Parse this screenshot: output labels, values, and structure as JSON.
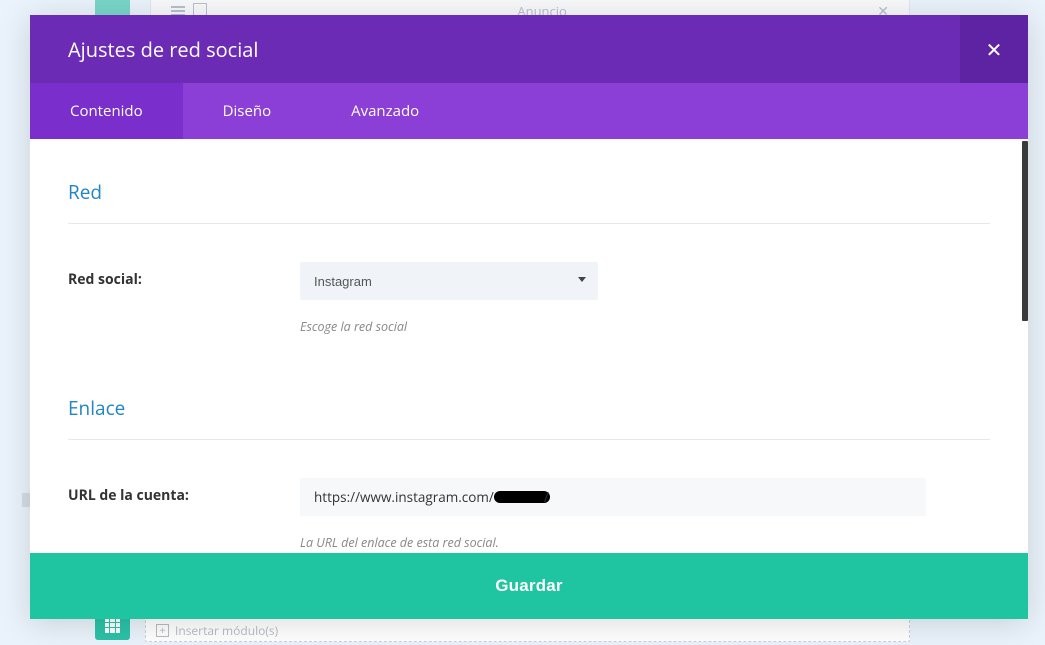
{
  "background": {
    "anuncio": "Anuncio",
    "insert_module": "Insertar módulo(s)"
  },
  "modal": {
    "title": "Ajustes de red social",
    "close_glyph": "✕"
  },
  "tabs": {
    "content": "Contenido",
    "design": "Diseño",
    "advanced": "Avanzado"
  },
  "sections": {
    "network": {
      "title": "Red",
      "field_label": "Red social:",
      "select_value": "Instagram",
      "helper": "Escoge la red social"
    },
    "link": {
      "title": "Enlace",
      "field_label": "URL de la cuenta:",
      "input_prefix": "https://www.instagram.com/",
      "input_suffix": "/",
      "helper": "La URL del enlace de esta red social."
    }
  },
  "save_label": "Guardar"
}
